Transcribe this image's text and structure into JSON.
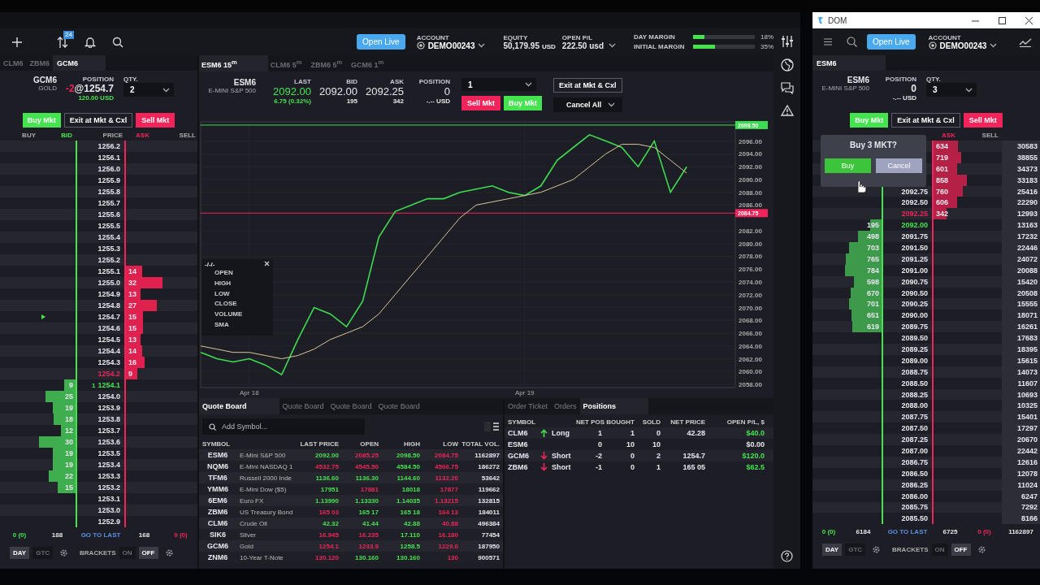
{
  "app": {
    "toolbar": {
      "badge": "24",
      "open_live": "Open Live",
      "account_label": "ACCOUNT",
      "account": "DEMO00243",
      "equity_label": "EQUITY",
      "equity": "50,179.95",
      "equity_unit": "USD",
      "openpl_label": "OPEN P/L",
      "openpl": "222.50 usd",
      "margins": [
        {
          "label": "DAY MARGIN",
          "level": 0.18,
          "reading": "18%"
        },
        {
          "label": "INITIAL MARGIN",
          "level": 0.35,
          "reading": "35%"
        }
      ]
    },
    "dom": {
      "tabs": [
        {
          "label": "CLM6",
          "selected": false
        },
        {
          "label": "ZBM6",
          "selected": false
        },
        {
          "label": "GCM6",
          "selected": true
        }
      ],
      "symbol": "GCM6",
      "desc": "GOLD",
      "position_label": "POSITION",
      "position_qty": "-2",
      "position_price": "@1254.7",
      "pl": "120.00 USD",
      "qty_label": "QTY.",
      "qty": "2",
      "buy": "Buy Mkt",
      "exit": "Exit at Mkt & Cxl",
      "sell": "Sell Mkt",
      "columns": [
        {
          "kind": "buy",
          "label": "BUY"
        },
        {
          "kind": "bid",
          "label": "BID"
        },
        {
          "kind": "price",
          "label": "PRICE"
        },
        {
          "kind": "ask",
          "label": "ASK"
        },
        {
          "kind": "sell",
          "label": "SELL"
        }
      ],
      "rows": [
        {
          "price": "1256.2"
        },
        {
          "price": "1256.1"
        },
        {
          "price": "1256.0"
        },
        {
          "price": "1255.9"
        },
        {
          "price": "1255.8"
        },
        {
          "price": "1255.7"
        },
        {
          "price": "1255.6"
        },
        {
          "price": "1255.5"
        },
        {
          "price": "1255.4"
        },
        {
          "price": "1255.3"
        },
        {
          "price": "1255.2"
        },
        {
          "price": "1255.1",
          "ask": "14"
        },
        {
          "price": "1255.0",
          "ask": "32"
        },
        {
          "price": "1254.9",
          "ask": "13"
        },
        {
          "price": "1254.8",
          "ask": "27"
        },
        {
          "price": "1254.7",
          "ask": "15",
          "position_marker": true
        },
        {
          "price": "1254.6",
          "ask": "15"
        },
        {
          "price": "1254.5",
          "ask": "13"
        },
        {
          "price": "1254.4",
          "ask": "14"
        },
        {
          "price": "1254.3",
          "ask": "16"
        },
        {
          "price": "1254.2",
          "ask": "9",
          "kind": "best_ask"
        },
        {
          "price": "1254.1",
          "bid": "9",
          "kind": "best_bid",
          "last_size": "1"
        },
        {
          "price": "1254.0",
          "bid": "25"
        },
        {
          "price": "1253.9",
          "bid": "19"
        },
        {
          "price": "1253.8",
          "bid": "18"
        },
        {
          "price": "1253.7",
          "bid": "12"
        },
        {
          "price": "1253.6",
          "bid": "30"
        },
        {
          "price": "1253.5",
          "bid": "19"
        },
        {
          "price": "1253.4",
          "bid": "19"
        },
        {
          "price": "1253.3",
          "bid": "22"
        },
        {
          "price": "1253.2",
          "bid": "15"
        },
        {
          "price": "1253.1"
        },
        {
          "price": "1253.0"
        },
        {
          "price": "1252.9"
        }
      ],
      "footer": [
        "0 (0)",
        "188",
        "GO TO LAST",
        "168",
        "0 (0)"
      ],
      "tif": [
        {
          "label": "DAY",
          "selected": true
        },
        {
          "label": "GTC",
          "selected": false
        }
      ],
      "brackets_label": "BRACKETS",
      "brackets": [
        {
          "label": "ON",
          "selected": false
        },
        {
          "label": "OFF",
          "selected": true
        }
      ]
    },
    "chart_tabs": [
      {
        "label": "ESM6 15$^{m}$",
        "selected": true
      },
      {
        "label": "CLM6 5$^{m}$",
        "selected": false
      },
      {
        "label": "ZBM6 5$^{m}$",
        "selected": false
      },
      {
        "label": "GCM6 1$^{m}$",
        "selected": false
      }
    ],
    "quote": {
      "symbol": "ESM6",
      "desc": "E-MINI S&P 500",
      "fields": [
        {
          "label": "LAST",
          "value": "2092.00",
          "sub": "6.75 (0.32%)",
          "up": true
        },
        {
          "label": "BID",
          "value": "2092.00",
          "sub": "195"
        },
        {
          "label": "ASK",
          "value": "2092.25",
          "sub": "342"
        },
        {
          "label": "POSITION",
          "value": "0",
          "sub": "-.-- USD"
        }
      ],
      "qty": "1",
      "sell": "Sell Mkt",
      "buy": "Buy Mkt",
      "exit": "Exit at Mkt & Cxl",
      "cancel_all": "Cancel All"
    },
    "chart": {
      "legend": {
        "title": "-/-/-",
        "items": [
          "OPEN",
          "HIGH",
          "LOW",
          "CLOSE",
          "VOLUME",
          "SMA"
        ]
      },
      "chart_data": {
        "type": "line",
        "grid": true,
        "categories": [
          null,
          null,
          null,
          "Apr 18",
          null,
          null,
          null,
          null,
          null,
          null,
          null,
          null,
          null,
          null,
          null,
          null,
          null,
          null,
          null,
          null,
          "Apr 19",
          null,
          null,
          null,
          null,
          null,
          null,
          null,
          null,
          null,
          null,
          null,
          null,
          null
        ],
        "ylim": [
          2057.5,
          2099
        ],
        "yticks": [
          {
            "value": 2058,
            "label": "2058.00"
          },
          {
            "value": 2060,
            "label": "2060.00"
          },
          {
            "value": 2062,
            "label": "2062.00"
          },
          {
            "value": 2064,
            "label": "2064.00"
          },
          {
            "value": 2066,
            "label": "2066.00"
          },
          {
            "value": 2068,
            "label": "2068.00"
          },
          {
            "value": 2070,
            "label": "2070.00"
          },
          {
            "value": 2072,
            "label": "2072.00"
          },
          {
            "value": 2074,
            "label": "2074.00"
          },
          {
            "value": 2076,
            "label": "2076.00"
          },
          {
            "value": 2078,
            "label": "2078.00"
          },
          {
            "value": 2080,
            "label": "2080.00"
          },
          {
            "value": 2082,
            "label": "2082.00"
          },
          {
            "value": 2086,
            "label": "2086.00"
          },
          {
            "value": 2088,
            "label": "2088.00"
          },
          {
            "value": 2090,
            "label": "2090.00"
          },
          {
            "value": 2092,
            "label": "2092.00"
          },
          {
            "value": 2094,
            "label": "2094.00"
          },
          {
            "value": 2096,
            "label": "2096.00"
          }
        ],
        "series": [
          {
            "color": "#3ddc52",
            "values": [
              2063,
              2062,
              2061.5,
              2062,
              2061,
              2059.5,
              2065,
              2070,
              2069,
              2067,
              2071,
              2081,
              2085,
              2086,
              2087,
              2087,
              2088,
              2088.5,
              2089,
              2088,
              2087.5,
              2089,
              2093,
              2095,
              2097,
              2096,
              2095,
              2092,
              2096,
              2088,
              2092,
              null,
              null,
              null
            ]
          },
          {
            "color": "#d8c89a",
            "values": [
              2064,
              2063.5,
              2063,
              2063,
              2062.5,
              2062,
              2062.5,
              2063.5,
              2065,
              2066,
              2067,
              2069,
              2072,
              2075,
              2078,
              2081,
              2084,
              2086,
              2086.5,
              2087,
              2087.5,
              2088,
              2089,
              2090,
              2092,
              2094,
              2095.5,
              2095.5,
              2095,
              2093,
              2091,
              null,
              null,
              null
            ]
          }
        ],
        "ref_lines": [
          {
            "axis": "y",
            "value": 2098.5,
            "label": "2098.50",
            "color": "#3ddc52"
          },
          {
            "axis": "y",
            "value": 2084.75,
            "label": "2084.75",
            "color": "#f0245a"
          }
        ]
      }
    },
    "quote_board": {
      "tabs": [
        {
          "label": "Quote Board",
          "selected": true
        },
        {
          "label": "Quote Board",
          "selected": false
        },
        {
          "label": "Quote Board",
          "selected": false
        },
        {
          "label": "Quote Board",
          "selected": false
        }
      ],
      "placeholder": "Add Symbol...",
      "columns": [
        "SYMBOL",
        "",
        "LAST PRICE",
        "OPEN",
        "HIGH",
        "LOW",
        "TOTAL VOL."
      ],
      "rows": [
        {
          "symbol": "ESM6",
          "name": "E-Mini S&P 500",
          "last": "2092.00",
          "last_up": true,
          "open": "2085.25",
          "open_up": false,
          "high": "2098.50",
          "high_up": true,
          "low": "2084.75",
          "low_up": false,
          "vol": "1162897"
        },
        {
          "symbol": "NQM6",
          "name": "E-Mini NASDAQ 1",
          "last": "4532.75",
          "last_up": false,
          "open": "4545.50",
          "open_up": false,
          "high": "4584.50",
          "high_up": true,
          "low": "4506.75",
          "low_up": false,
          "vol": "186272"
        },
        {
          "symbol": "TFM6",
          "name": "Russell 2000 Inde",
          "last": "1136.60",
          "last_up": true,
          "open": "1136.30",
          "open_up": true,
          "high": "1144.60",
          "high_up": true,
          "low": "1132.20",
          "low_up": false,
          "vol": "53642"
        },
        {
          "symbol": "YMM6",
          "name": "E-Mini Dow ($5)",
          "last": "17951",
          "last_up": true,
          "open": "17881",
          "open_up": false,
          "high": "18018",
          "high_up": true,
          "low": "17877",
          "low_up": false,
          "vol": "119662"
        },
        {
          "symbol": "6EM6",
          "name": "Euro FX",
          "last": "1.13990",
          "last_up": true,
          "open": "1.13330",
          "open_up": true,
          "high": "1.14035",
          "high_up": true,
          "low": "1.13215",
          "low_up": false,
          "vol": "132815"
        },
        {
          "symbol": "ZBM6",
          "name": "US Treasury Bond",
          "last": "165 03",
          "last_up": false,
          "open": "165 17",
          "open_up": true,
          "high": "165 18",
          "high_up": true,
          "low": "164 13",
          "low_up": false,
          "vol": "184011"
        },
        {
          "symbol": "CLM6",
          "name": "Crude Oil",
          "last": "42.32",
          "last_up": true,
          "open": "41.44",
          "open_up": true,
          "high": "42.88",
          "high_up": true,
          "low": "40.88",
          "low_up": false,
          "vol": "496384"
        },
        {
          "symbol": "SIK6",
          "name": "Silver",
          "last": "16.945",
          "last_up": false,
          "open": "16.235",
          "open_up": false,
          "high": "17.110",
          "high_up": true,
          "low": "16.180",
          "low_up": false,
          "vol": "77454"
        },
        {
          "symbol": "GCM6",
          "name": "Gold",
          "last": "1254.1",
          "last_up": false,
          "open": "1233.9",
          "open_up": false,
          "high": "1258.5",
          "high_up": true,
          "low": "1229.0",
          "low_up": false,
          "vol": "187950"
        },
        {
          "symbol": "ZNM6",
          "name": "10-Year T-Note",
          "last": "130.120",
          "last_up": false,
          "open": "130.160",
          "open_up": true,
          "high": "130.160",
          "high_up": true,
          "low": "130",
          "low_up": false,
          "vol": "900571"
        }
      ]
    },
    "positions": {
      "tabs": [
        {
          "label": "Order Ticket",
          "selected": false
        },
        {
          "label": "Orders",
          "selected": false
        },
        {
          "label": "Positions",
          "selected": true
        }
      ],
      "columns": [
        "SYMBOL",
        "",
        "NET POS",
        "BOUGHT",
        "SOLD",
        "NET PRICE",
        "OPEN P/L, $"
      ],
      "rows": [
        {
          "symbol": "CLM6",
          "kind": "long",
          "side_label": "Long",
          "net": "1",
          "bought": "1",
          "sold": "0",
          "price": "42.28",
          "pl": "$40.0"
        },
        {
          "symbol": "ESM6",
          "net": "0",
          "bought": "10",
          "sold": "10",
          "pl": "$0.00"
        },
        {
          "symbol": "GCM6",
          "kind": "short",
          "side_label": "Short",
          "net": "-2",
          "bought": "0",
          "sold": "2",
          "price": "1254.7",
          "pl": "$120.0"
        },
        {
          "symbol": "ZBM6",
          "kind": "short",
          "side_label": "Short",
          "net": "-1",
          "bought": "0",
          "sold": "1",
          "price": "165 05",
          "pl": "$62.5"
        }
      ]
    }
  },
  "dom_window": {
    "title": "DOM",
    "open_live": "Open Live",
    "account_label": "ACCOUNT",
    "account": "DEMO00243",
    "dom": {
      "tabs": [
        {
          "label": "ESM6",
          "selected": true
        }
      ],
      "symbol": "ESM6",
      "desc": "E-MINI S&P 500",
      "position_label": "POSITION",
      "position_qty": "0",
      "pl": "-.-- USD",
      "qty_label": "QTY.",
      "qty": "3",
      "buy": "Buy Mkt",
      "exit": "Exit at Mkt & Cxl",
      "sell": "Sell Mkt",
      "columns": [
        {
          "kind": "ask",
          "label": "ASK"
        },
        {
          "kind": "sell",
          "label": "SELL"
        }
      ],
      "rows": [
        {
          "ask": "634",
          "vol": "30583"
        },
        {
          "ask": "719",
          "vol": "38855"
        },
        {
          "ask": "601",
          "vol": "34373"
        },
        {
          "ask": "858",
          "vol": "33183"
        },
        {
          "price": "2092.75",
          "ask": "760",
          "vol": "25416"
        },
        {
          "price": "2092.50",
          "ask": "606",
          "vol": "22290"
        },
        {
          "price": "2092.25",
          "ask": "342",
          "vol": "12993",
          "kind": "best_ask"
        },
        {
          "price": "2092.00",
          "bid": "195",
          "vol": "13163",
          "kind": "best_bid"
        },
        {
          "price": "2091.75",
          "bid": "498",
          "vol": "17232"
        },
        {
          "price": "2091.50",
          "bid": "703",
          "vol": "22446"
        },
        {
          "price": "2091.25",
          "bid": "765",
          "vol": "24072"
        },
        {
          "price": "2091.00",
          "bid": "784",
          "vol": "20088"
        },
        {
          "price": "2090.75",
          "bid": "598",
          "vol": "15420"
        },
        {
          "price": "2090.50",
          "bid": "670",
          "vol": "20508"
        },
        {
          "price": "2090.25",
          "bid": "701",
          "vol": "15555"
        },
        {
          "price": "2090.00",
          "bid": "651",
          "vol": "18071"
        },
        {
          "price": "2089.75",
          "bid": "619",
          "vol": "16261"
        },
        {
          "price": "2089.50",
          "vol": "17683"
        },
        {
          "price": "2089.25",
          "vol": "18395"
        },
        {
          "price": "2089.00",
          "vol": "15615"
        },
        {
          "price": "2088.75",
          "vol": "14073"
        },
        {
          "price": "2088.50",
          "vol": "11607"
        },
        {
          "price": "2088.25",
          "vol": "10693"
        },
        {
          "price": "2088.00",
          "vol": "10325"
        },
        {
          "price": "2087.75",
          "vol": "15401"
        },
        {
          "price": "2087.50",
          "vol": "17297"
        },
        {
          "price": "2087.25",
          "vol": "20670"
        },
        {
          "price": "2087.00",
          "vol": "22442"
        },
        {
          "price": "2086.75",
          "vol": "12616"
        },
        {
          "price": "2086.50",
          "vol": "12078"
        },
        {
          "price": "2086.25",
          "vol": "11024"
        },
        {
          "price": "2086.00",
          "vol": "6247"
        },
        {
          "price": "2085.75",
          "vol": "7292"
        },
        {
          "price": "2085.50",
          "vol": "8166"
        }
      ],
      "footer": [
        "0 (0)",
        "6184",
        "GO TO LAST",
        "6725",
        "0 (0)",
        "1162897"
      ],
      "tif": [
        {
          "label": "DAY",
          "selected": true
        },
        {
          "label": "GTC",
          "selected": false
        }
      ],
      "brackets_label": "BRACKETS",
      "brackets": [
        {
          "label": "ON",
          "selected": false
        },
        {
          "label": "OFF",
          "selected": true
        }
      ]
    },
    "popup": {
      "title": "Buy 3 MKT?",
      "confirm": "Buy",
      "cancel": "Cancel"
    }
  }
}
